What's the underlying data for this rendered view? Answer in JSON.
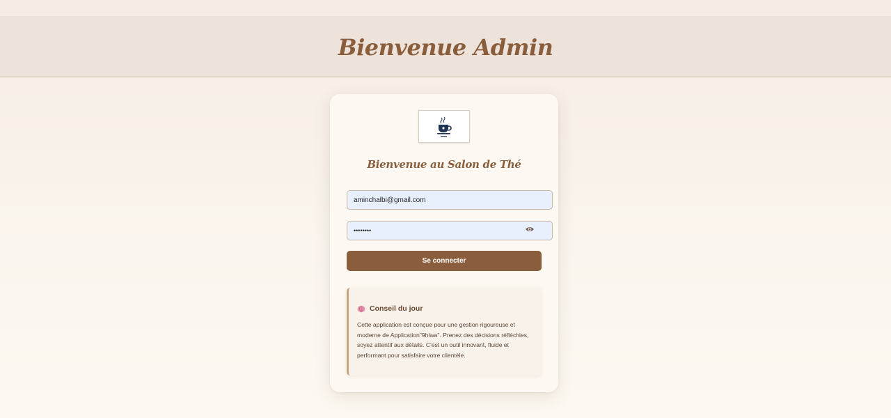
{
  "header": {
    "title": "Bienvenue Admin"
  },
  "card": {
    "logo_icon": "tea-cup-logo-icon",
    "title": "Bienvenue au Salon de Thé",
    "email": {
      "value": "aminchalbi@gmail.com"
    },
    "password": {
      "value": "password",
      "toggle_icon": "eye-icon"
    },
    "submit_label": "Se connecter",
    "tip": {
      "icon": "brain-icon",
      "title": "Conseil du jour",
      "text": "Cette application est conçue pour une gestion rigoureuse et moderne de Application\"9hiwa\". Prenez des décisions réfléchies, soyez attentif aux détails. C'est un outil innovant, fluide et performant pour satisfaire votre clientèle."
    }
  },
  "colors": {
    "brand": "#8a5e3c",
    "header_bg": "#eee3da",
    "card_bg": "#fdf9f2",
    "input_bg": "#e8f0fe"
  }
}
